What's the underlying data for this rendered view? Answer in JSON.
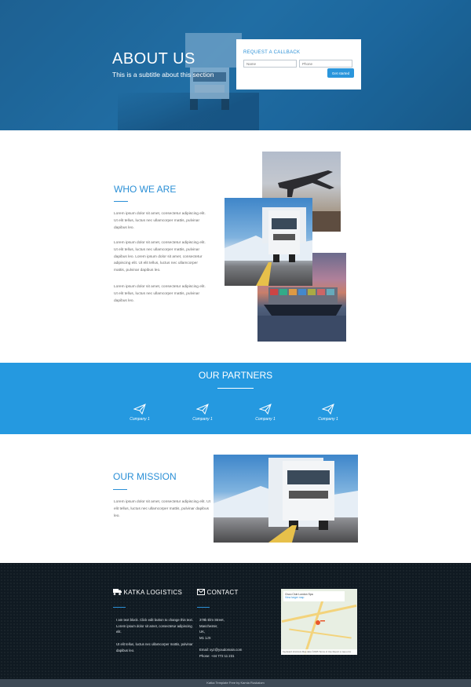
{
  "hero": {
    "title": "ABOUT US",
    "subtitle": "This is a subtitle about this section"
  },
  "callback": {
    "title": "REQUEST A CALLBACK",
    "name_placeholder": "Name",
    "phone_placeholder": "Phone",
    "button_label": "Get started"
  },
  "who": {
    "title": "WHO WE ARE",
    "paragraphs": [
      "Lorem ipsum dolor sit amet, consectetur adipiscing elit. Ut elit tellus, luctus nec ullamcorper mattis, pulvinar dapibus leo.",
      "Lorem ipsum dolor sit amet, consectetur adipiscing elit. Ut elit tellus, luctus nec ullamcorper mattis, pulvinar dapibus leo. Lorem ipsum dolor sit amet, consectetur adipiscing elit. Ut elit tellus, luctus nec ullamcorper mattis, pulvinar dapibus leo.",
      "Lorem ipsum dolor sit amet, consectetur adipiscing elit. Ut elit tellus, luctus nec ullamcorper mattis, pulvinar dapibus leo."
    ]
  },
  "partners": {
    "title": "OUR PARTNERS",
    "companies": [
      "Company 1",
      "Company 1",
      "Company 1",
      "Company 1"
    ]
  },
  "mission": {
    "title": "OUR MISSION",
    "text": "Lorem ipsum dolor sit amet, consectetur adipiscing elit. Ut elit tellus, luctus nec ullamcorper mattis, pulvinar dapibus leo."
  },
  "footer": {
    "brand_title": "KATKA LOGISTICS",
    "brand_text_1": "I am text block. Click edit button to change this text. Lorem ipsum dolor sit amet, consectetur adipiscing elit.",
    "brand_text_2": "Ut elit tellus, luctus nec ullamcorper mattis, pulvinar dapibus leo.",
    "contact_title": "CONTACT",
    "address": [
      "378k Elm Street,",
      "Manchester,",
      "UK,",
      "M1 1JX"
    ],
    "email": "Email: xyz@youdomain.com",
    "phone": "Phone: +44 772 11 231",
    "map_place": "Cisco Club London Spa",
    "map_link": "View larger map",
    "map_footer": "Keyboard shortcuts   Map data ©2025   Terms of Use   Report a map error",
    "bottom_text": "Katka Template Free by Kamia Ruskaiom"
  }
}
